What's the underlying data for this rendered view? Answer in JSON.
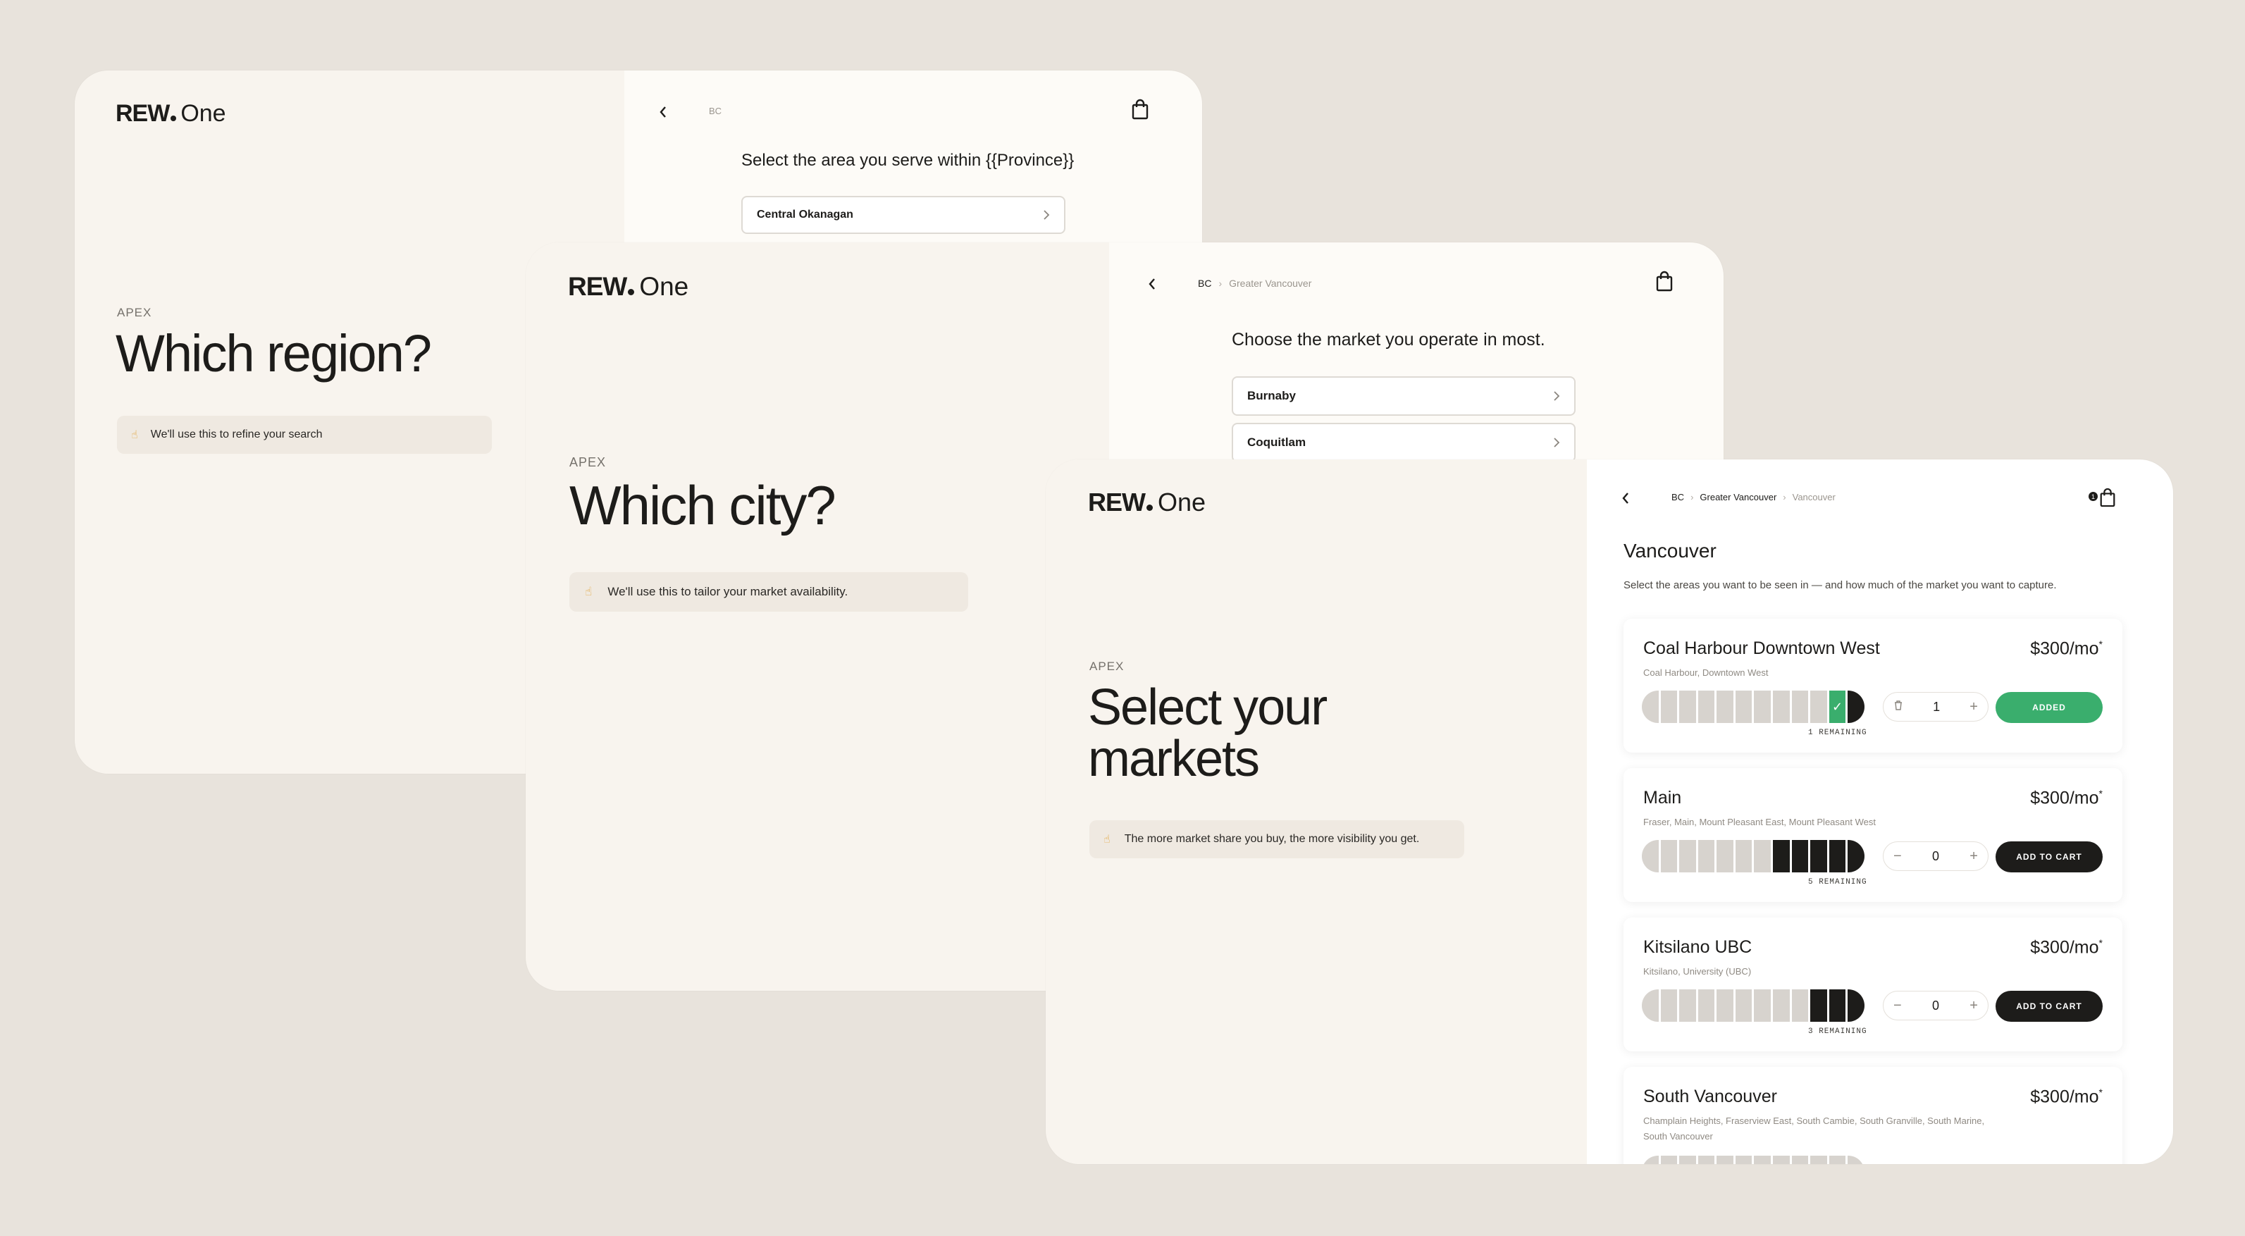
{
  "brand": {
    "name_bold": "REW",
    "name_light": "One"
  },
  "screen_region": {
    "eyebrow": "APEX",
    "heading": "Which region?",
    "hint_icon": "☝",
    "hint": "We'll use this to refine your search",
    "crumbs": [
      "BC"
    ],
    "question": "Select the area you serve within {{Province}}",
    "options": [
      "Central Okanagan"
    ]
  },
  "screen_city": {
    "eyebrow": "APEX",
    "heading": "Which city?",
    "hint_icon": "☝",
    "hint": "We'll use this to tailor your market availability.",
    "crumbs": [
      "BC",
      "Greater Vancouver"
    ],
    "question": "Choose the market you operate in most.",
    "options": [
      "Burnaby",
      "Coquitlam"
    ]
  },
  "screen_markets": {
    "eyebrow": "APEX",
    "heading_line1": "Select your",
    "heading_line2": "markets",
    "hint_icon": "☝",
    "hint": "The more market share you buy, the more visibility you get.",
    "crumbs": [
      "BC",
      "Greater Vancouver",
      "Vancouver"
    ],
    "cart_count": "1",
    "title": "Vancouver",
    "subtitle": "Select the areas you want to be seen in — and how much of the market you want to capture.",
    "markets": [
      {
        "name": "Coal Harbour Downtown West",
        "price": "$300/mo",
        "price_mark": "*",
        "areas": "Coal Harbour, Downtown West",
        "remaining": "1 REMAINING",
        "qty": "1",
        "action": "ADDED",
        "segments_total": 12,
        "segments_sold": 1,
        "segments_mine": 1
      },
      {
        "name": "Main",
        "price": "$300/mo",
        "price_mark": "*",
        "areas": "Fraser, Main, Mount Pleasant East, Mount Pleasant West",
        "remaining": "5 REMAINING",
        "qty": "0",
        "action": "ADD TO CART",
        "segments_total": 12,
        "segments_sold": 5,
        "segments_mine": 0
      },
      {
        "name": "Kitsilano UBC",
        "price": "$300/mo",
        "price_mark": "*",
        "areas": "Kitsilano, University (UBC)",
        "remaining": "3 REMAINING",
        "qty": "0",
        "action": "ADD TO CART",
        "segments_total": 12,
        "segments_sold": 3,
        "segments_mine": 0
      },
      {
        "name": "South Vancouver",
        "price": "$300/mo",
        "price_mark": "*",
        "areas": "Champlain Heights, Fraserview East, South Cambie, South Granville, South Marine, South Vancouver",
        "remaining": "",
        "qty": "0",
        "action": "",
        "segments_total": 12,
        "segments_sold": 0,
        "segments_mine": 0
      }
    ]
  },
  "colors": {
    "background": "#e8e3dc",
    "panel_left": "#f8f4ee",
    "panel_right": "#fdfbf7",
    "accent_green": "#3aae6d",
    "ink": "#1d1c1a",
    "hint_icon": "#e2a53b"
  }
}
